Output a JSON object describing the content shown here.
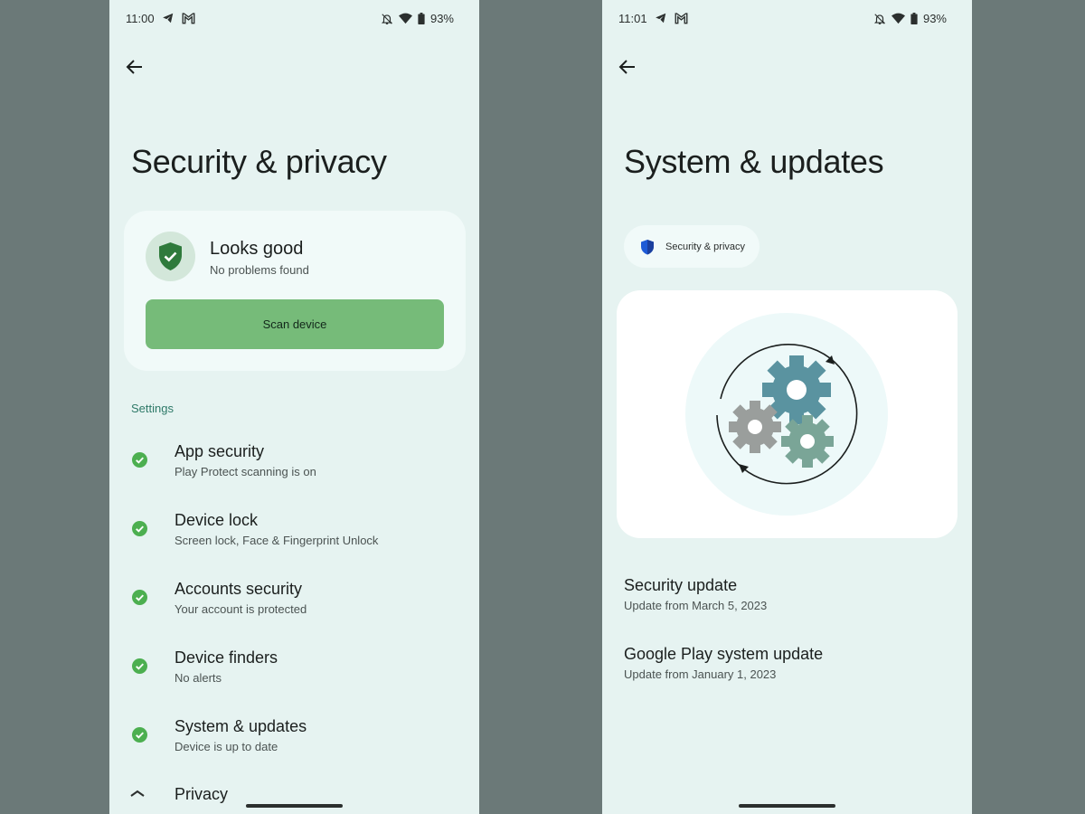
{
  "left": {
    "status": {
      "time": "11:00",
      "battery": "93%"
    },
    "title": "Security & privacy",
    "card": {
      "title": "Looks good",
      "subtitle": "No problems found",
      "button": "Scan device"
    },
    "section": "Settings",
    "items": [
      {
        "title": "App security",
        "subtitle": "Play Protect scanning is on"
      },
      {
        "title": "Device lock",
        "subtitle": "Screen lock, Face & Fingerprint Unlock"
      },
      {
        "title": "Accounts security",
        "subtitle": "Your account is protected"
      },
      {
        "title": "Device finders",
        "subtitle": "No alerts"
      },
      {
        "title": "System & updates",
        "subtitle": "Device is up to date"
      }
    ],
    "privacy": "Privacy"
  },
  "right": {
    "status": {
      "time": "11:01",
      "battery": "93%"
    },
    "title": "System & updates",
    "chip": "Security & privacy",
    "updates": [
      {
        "title": "Security update",
        "subtitle": "Update from March 5, 2023"
      },
      {
        "title": "Google Play system update",
        "subtitle": "Update from January 1, 2023"
      }
    ]
  },
  "icons": {
    "back": "arrow-back-icon",
    "telegram": "telegram-icon",
    "gmail": "gmail-icon",
    "bell_off": "notifications-off-icon",
    "wifi": "wifi-icon",
    "battery": "battery-icon",
    "shield": "shield-check-icon",
    "check": "check-circle-icon",
    "chevron": "chevron-up-icon",
    "gears": "gears-sync-icon"
  },
  "colors": {
    "background": "#6b7978",
    "screen": "#e6f3f1",
    "card": "#f1faf9",
    "accent_green": "#76bb79",
    "check_green": "#4caf50",
    "section_teal": "#2e7968",
    "chip_shield_blue": "#1e5bd6",
    "gear_teal": "#5a93a0",
    "gear_gray": "#9a9e9c",
    "gear_green": "#7aa597"
  }
}
